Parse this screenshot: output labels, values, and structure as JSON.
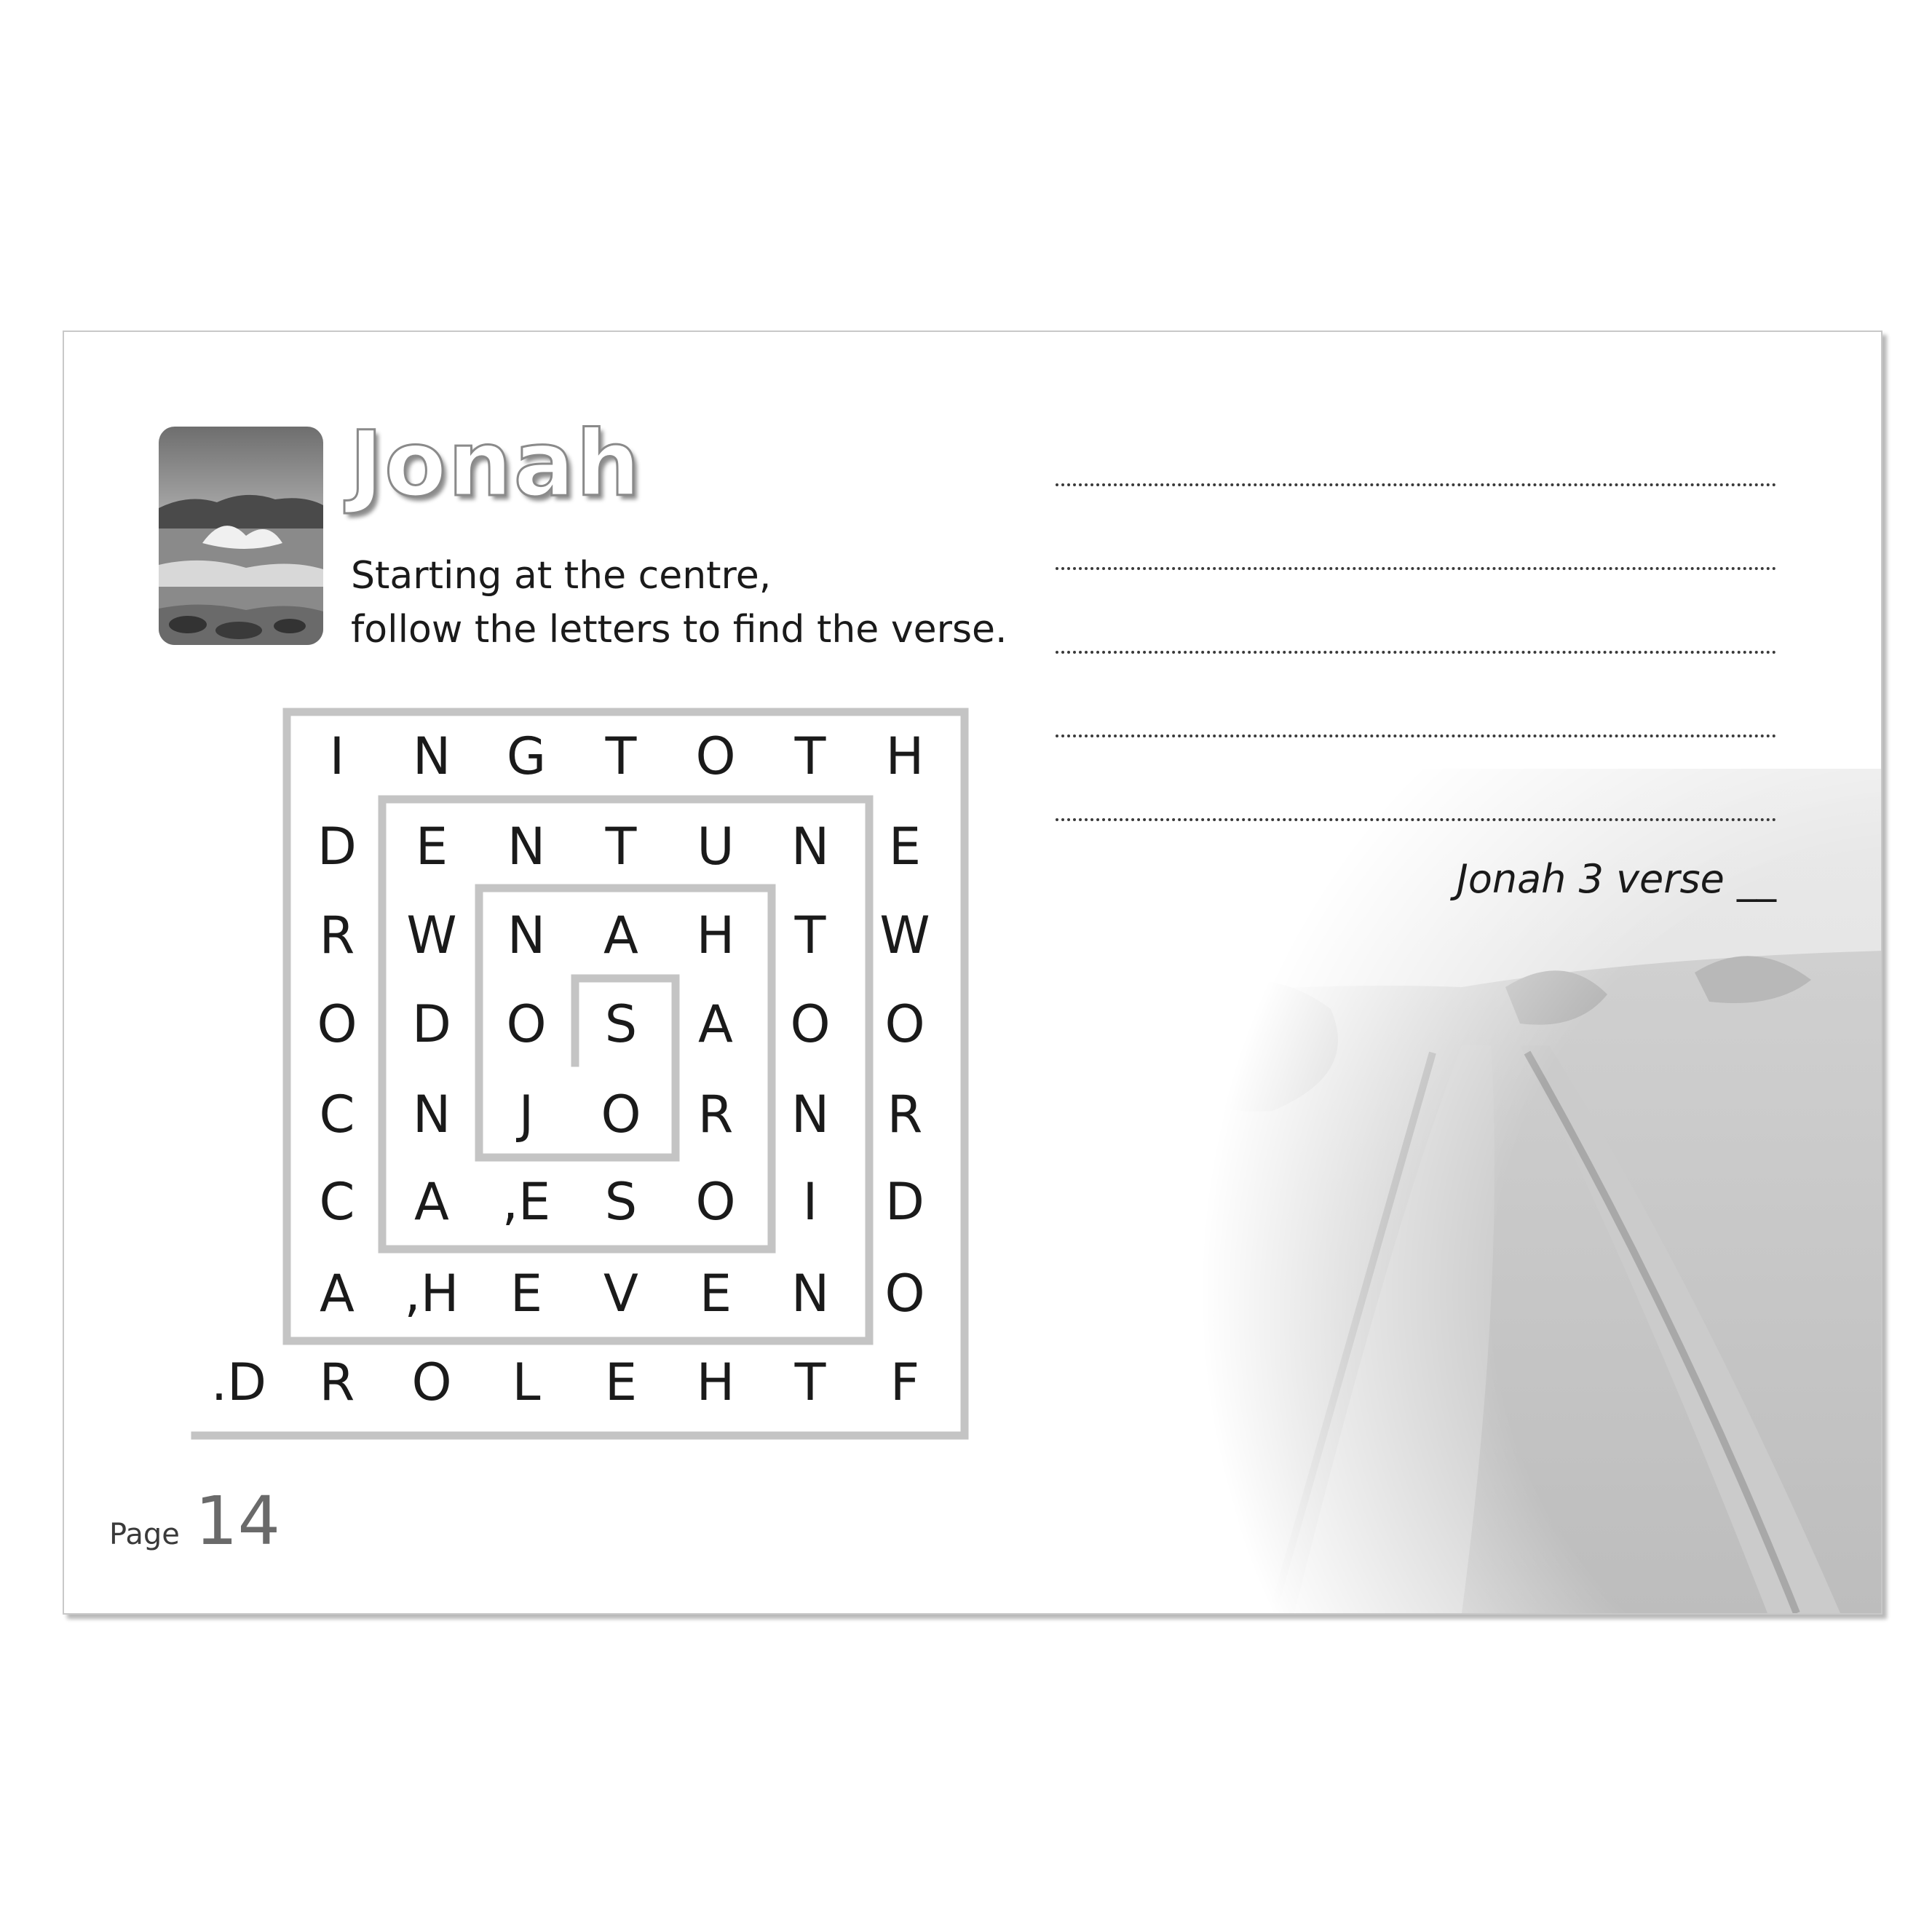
{
  "title": "Jonah",
  "instructions": {
    "line1": "Starting at the centre,",
    "line2": "follow the letters to find the verse."
  },
  "puzzle": {
    "rows": [
      [
        "I",
        "N",
        "G",
        "T",
        "O",
        "T",
        "H"
      ],
      [
        "D",
        "E",
        "N",
        "T",
        "U",
        "N",
        "E"
      ],
      [
        "R",
        "W",
        "N",
        "A",
        "H",
        "T",
        "W"
      ],
      [
        "O",
        "D",
        "O",
        "S",
        "A",
        "O",
        "O"
      ],
      [
        "C",
        "N",
        "J",
        "O",
        "R",
        "N",
        "R"
      ],
      [
        "C",
        "A",
        ",E",
        "S",
        "O",
        "I",
        "D"
      ],
      [
        "A",
        ",H",
        "E",
        "V",
        "E",
        "N",
        "O"
      ],
      [
        ".D",
        "R",
        "O",
        "L",
        "E",
        "H",
        "T",
        "F"
      ]
    ]
  },
  "answer_lines": 5,
  "verse_reference": "Jonah 3 verse __",
  "footer": {
    "page_label": "Page",
    "page_number": "14"
  },
  "colors": {
    "maze_line": "#c4c4c4",
    "text": "#1a1a1a",
    "page_number": "#6a6a6a"
  },
  "images": {
    "thumbnail": "stormy-sea-photo",
    "background": "dirt-road-landscape-photo"
  }
}
